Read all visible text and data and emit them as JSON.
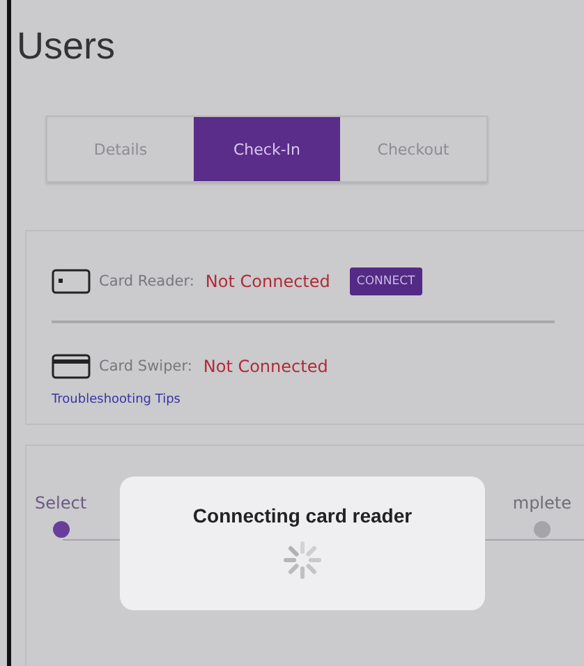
{
  "title": "Users",
  "tabs": [
    {
      "label": "Details",
      "selected": false
    },
    {
      "label": "Check-In",
      "selected": true
    },
    {
      "label": "Checkout",
      "selected": false
    }
  ],
  "devices": [
    {
      "kind": "reader",
      "name": "Card Reader:",
      "status": "Not Connected",
      "action": "CONNECT"
    },
    {
      "kind": "swiper",
      "name": "Card Swiper:",
      "status": "Not Connected"
    }
  ],
  "troubleshooting_link": "Troubleshooting Tips",
  "stepper": {
    "steps": [
      {
        "label": "Select",
        "selected": true
      },
      {
        "label": "mplete",
        "selected": false
      }
    ]
  },
  "dialog": {
    "message": "Connecting card reader"
  }
}
